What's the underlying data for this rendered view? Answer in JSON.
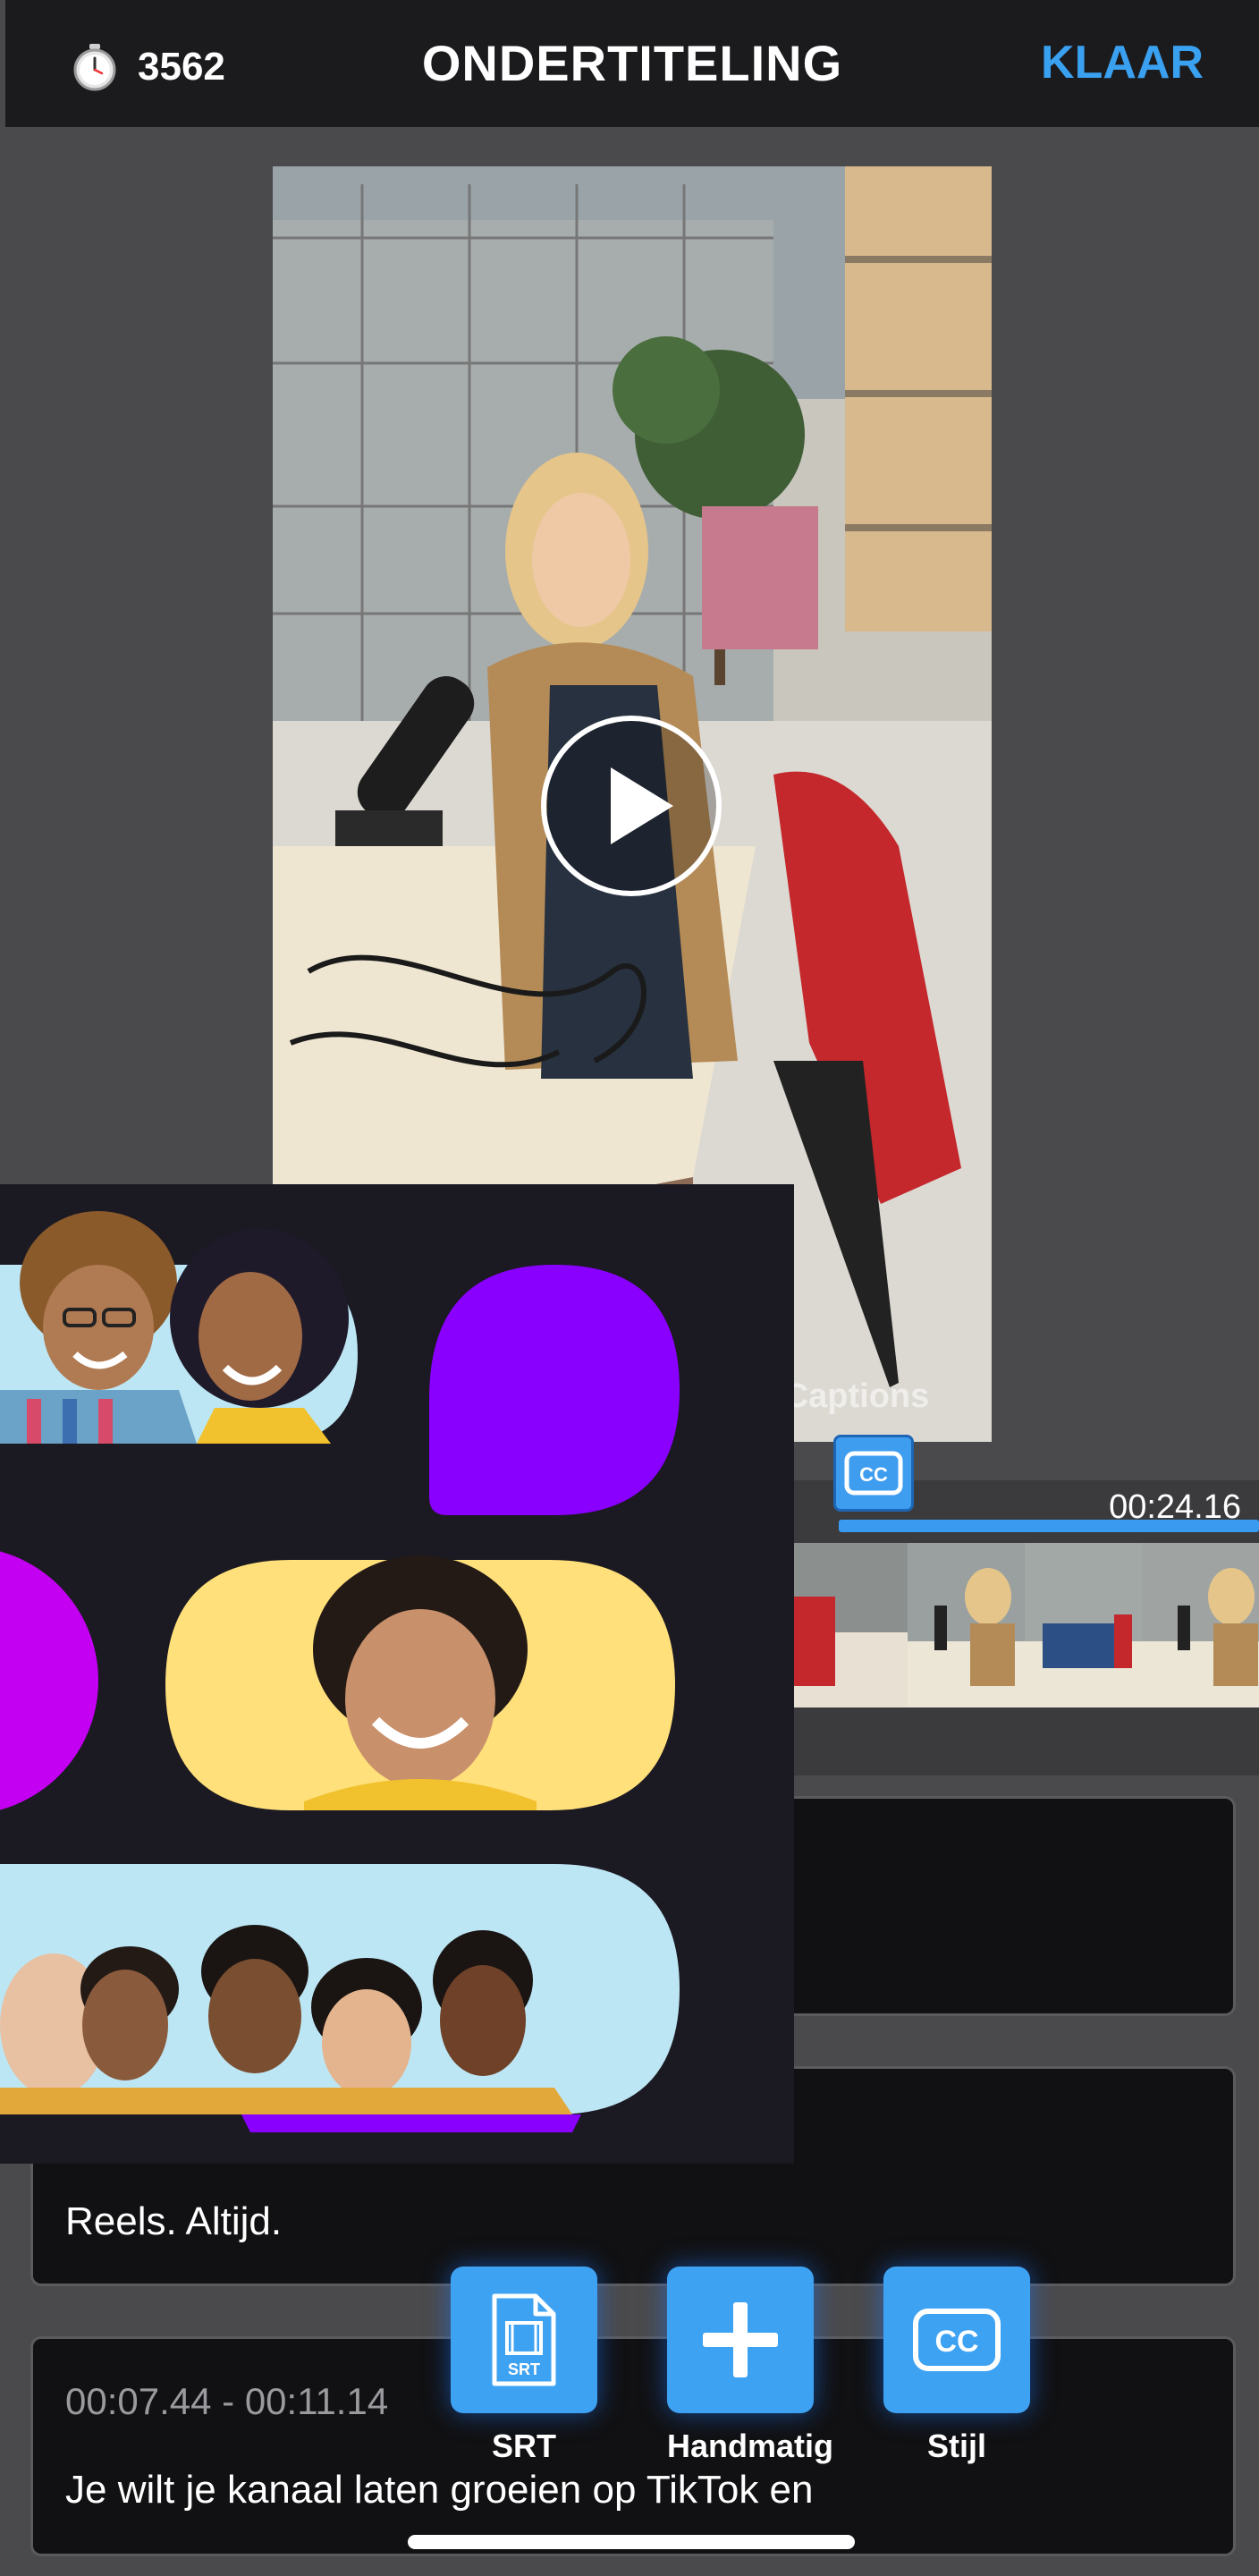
{
  "header": {
    "credits": "3562",
    "title": "ONDERTITELING",
    "done_label": "KLAAR"
  },
  "video": {
    "watermark": "ixCaptions"
  },
  "timeline": {
    "current_time": "00:24.16"
  },
  "captions": [
    {
      "time": "",
      "text": ""
    },
    {
      "time": "",
      "text": "Reels. Altijd."
    },
    {
      "time": "00:07.44 - 00:11.14",
      "text": "Je wilt je kanaal laten groeien op TikTok en"
    }
  ],
  "actions": {
    "srt_label": "SRT",
    "srt_icon_text": "SRT",
    "manual_label": "Handmatig",
    "style_label": "Stijl",
    "cc_text": "CC"
  },
  "colors": {
    "accent": "#3aa0f0",
    "background": "#4a4a4c",
    "topbar": "#1b1b1d",
    "card": "#111113",
    "ad_background": "#1b1922",
    "ad_purple": "#8a00ff",
    "ad_magenta": "#c400f2",
    "ad_yellow": "#ffe07a",
    "ad_lightblue": "#bde6f4"
  }
}
